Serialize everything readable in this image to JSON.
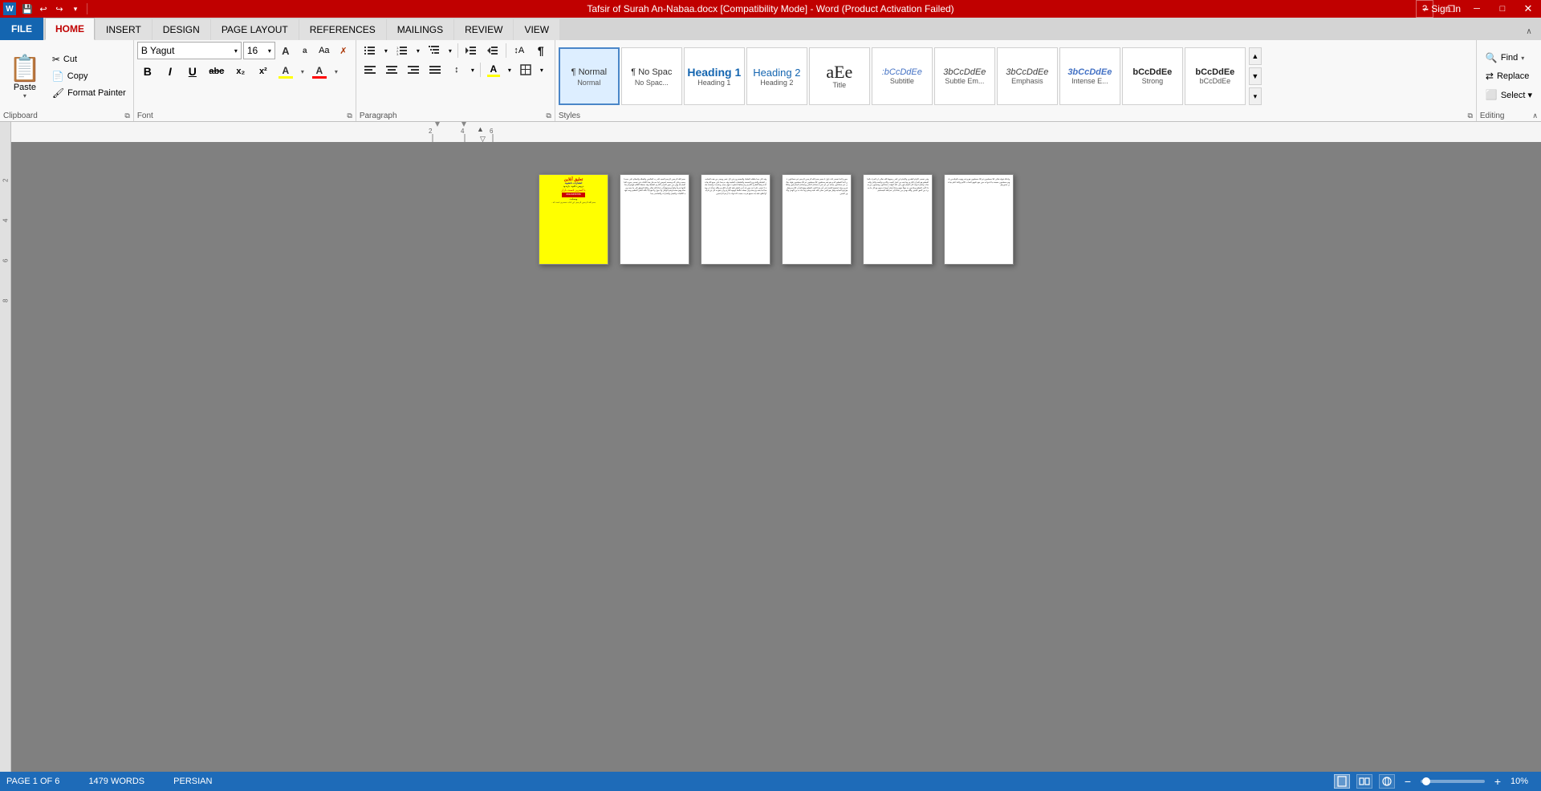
{
  "titlebar": {
    "title": "Tafsir of Surah An-Nabaa.docx [Compatibility Mode] - Word (Product Activation Failed)",
    "help": "?",
    "restore": "❐",
    "minimize": "—",
    "maximize": "□",
    "close": "✕",
    "signin": "Sign in"
  },
  "qat": {
    "save": "💾",
    "undo": "↩",
    "redo": "↪",
    "more": "▾"
  },
  "tabs": [
    {
      "label": "FILE",
      "active": false,
      "isFile": true
    },
    {
      "label": "HOME",
      "active": true
    },
    {
      "label": "INSERT",
      "active": false
    },
    {
      "label": "DESIGN",
      "active": false
    },
    {
      "label": "PAGE LAYOUT",
      "active": false
    },
    {
      "label": "REFERENCES",
      "active": false
    },
    {
      "label": "MAILINGS",
      "active": false
    },
    {
      "label": "REVIEW",
      "active": false
    },
    {
      "label": "VIEW",
      "active": false
    }
  ],
  "clipboard": {
    "paste_label": "Paste",
    "cut_label": "Cut",
    "copy_label": "Copy",
    "format_painter_label": "Format Painter",
    "group_label": "Clipboard"
  },
  "font": {
    "name": "B Yagut",
    "size": "16",
    "bold": "B",
    "italic": "I",
    "underline": "U",
    "strikethrough": "abc",
    "subscript": "x₂",
    "superscript": "x²",
    "grow": "A",
    "shrink": "a",
    "change_case": "Aa",
    "clear_format": "✗",
    "highlight_color": "A",
    "font_color": "A",
    "group_label": "Font"
  },
  "paragraph": {
    "bullets": "☰",
    "numbering": "☰",
    "multilevel": "☰",
    "decrease_indent": "⇤",
    "increase_indent": "⇥",
    "left": "≡",
    "center": "≡",
    "right": "≡",
    "justify": "≡",
    "sort": "↕",
    "show_marks": "¶",
    "line_spacing": "↕",
    "shading": "A",
    "border": "□",
    "group_label": "Paragraph"
  },
  "styles": [
    {
      "name": "Normal",
      "preview": "¶ Normal",
      "active": true
    },
    {
      "name": "No Spac...",
      "preview": "¶ No Spac"
    },
    {
      "name": "Heading 1",
      "preview": "Heading 1"
    },
    {
      "name": "Heading 2",
      "preview": "Heading 2"
    },
    {
      "name": "Title",
      "preview": "aЕe"
    },
    {
      "name": "Subtitle",
      "preview": "Subtitle"
    },
    {
      "name": "Subtle Em...",
      "preview": "Subtle Em"
    },
    {
      "name": "Emphasis",
      "preview": "Emphasis"
    },
    {
      "name": "Intense E...",
      "preview": "Intense E"
    },
    {
      "name": "Strong",
      "preview": "Strong"
    },
    {
      "name": "bCcDdEe",
      "preview": "bCcDdEe"
    }
  ],
  "styles_group_label": "Styles",
  "editing": {
    "find_label": "Find",
    "replace_label": "Replace",
    "select_label": "Select ▾",
    "group_label": "Editing"
  },
  "ruler": {
    "markers": [
      "2",
      "4",
      "6",
      "8"
    ]
  },
  "statusbar": {
    "page_info": "PAGE 1 OF 6",
    "words": "1479 WORDS",
    "language": "PERSIAN"
  },
  "zoom": {
    "percent": "10%",
    "minus": "−",
    "plus": "+"
  },
  "pages": [
    {
      "id": 1,
      "has_ad": true
    },
    {
      "id": 2
    },
    {
      "id": 3
    },
    {
      "id": 4
    },
    {
      "id": 5
    },
    {
      "id": 6
    }
  ]
}
